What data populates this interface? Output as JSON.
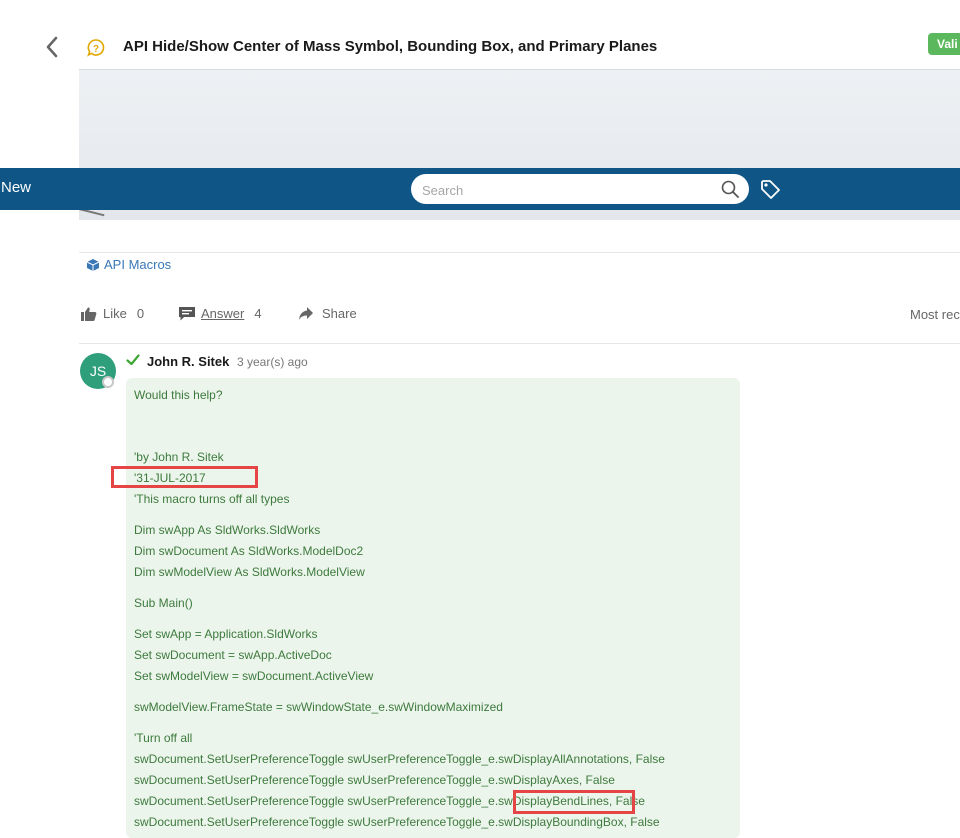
{
  "header": {
    "title": "API Hide/Show Center of Mass Symbol, Bounding Box, and Primary Planes",
    "badge": "Vali"
  },
  "navbar": {
    "new_label": "New",
    "search_placeholder": "Search",
    "search_value": ""
  },
  "topic": {
    "label": "API Macros"
  },
  "actions": {
    "like_label": "Like",
    "like_count": "0",
    "answer_label": "Answer",
    "answer_count": "4",
    "share_label": "Share",
    "sort_label": "Most rec"
  },
  "answer": {
    "avatar_initials": "JS",
    "author": "John R. Sitek",
    "time_ago": "3 year(s) ago",
    "lines": [
      "Would this help?",
      "'by John R. Sitek",
      "'31-JUL-2017",
      "'This macro turns off all types",
      "Dim swApp As SldWorks.SldWorks",
      "Dim swDocument As SldWorks.ModelDoc2",
      "Dim swModelView As SldWorks.ModelView",
      "Sub Main()",
      "Set swApp = Application.SldWorks",
      "Set swDocument = swApp.ActiveDoc",
      "Set swModelView = swDocument.ActiveView",
      "swModelView.FrameState = swWindowState_e.swWindowMaximized",
      "'Turn off all",
      "swDocument.SetUserPreferenceToggle swUserPreferenceToggle_e.swDisplayAllAnnotations, False",
      "swDocument.SetUserPreferenceToggle swUserPreferenceToggle_e.swDisplayAxes, False",
      "swDocument.SetUserPreferenceToggle swUserPreferenceToggle_e.swDisplayBendLines, False",
      "swDocument.SetUserPreferenceToggle swUserPreferenceToggle_e.swDisplayBoundingBox, False"
    ]
  },
  "icons": {
    "back": "chevron-left-icon",
    "question": "question-bubble-icon",
    "search": "search-icon",
    "tag": "tag-icon",
    "topic": "cube-icon",
    "like": "thumbs-up-icon",
    "answer": "comment-icon",
    "share": "share-arrow-icon",
    "accepted": "check-icon"
  },
  "colors": {
    "navbar": "#0f5687",
    "badge": "#5cb85c",
    "link": "#3a78b5",
    "answer_bg": "#ecf5ec",
    "answer_text": "#3d7a3d",
    "highlight": "#e64545"
  }
}
